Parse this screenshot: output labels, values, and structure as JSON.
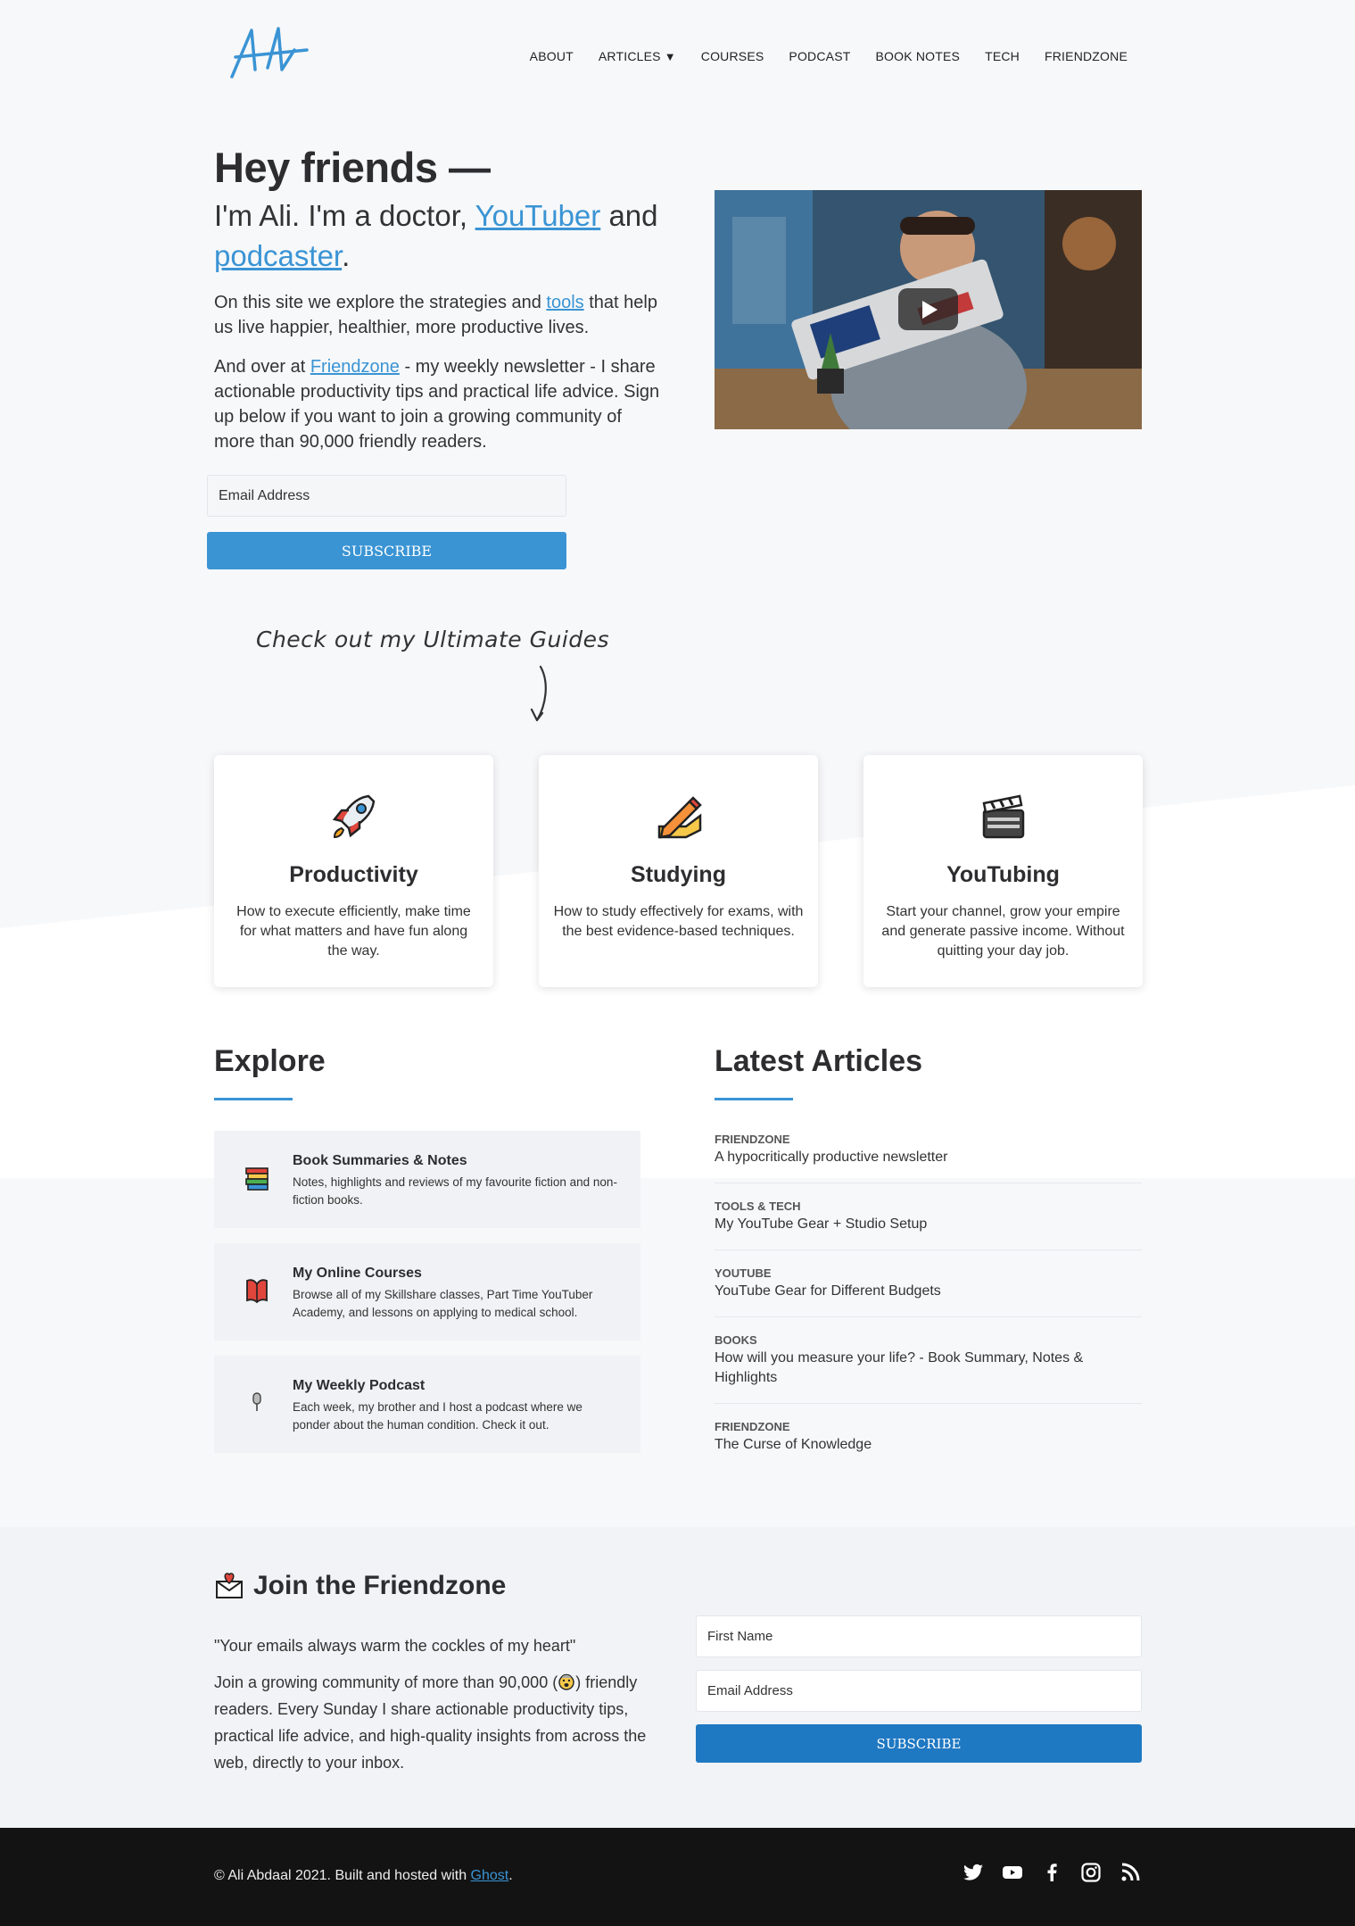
{
  "nav": {
    "items": [
      "ABOUT",
      "ARTICLES",
      "COURSES",
      "PODCAST",
      "BOOK NOTES",
      "TECH",
      "FRIENDZONE"
    ],
    "articles_caret": "▼"
  },
  "hero": {
    "title": "Hey friends —",
    "sub_pre": "I'm Ali. I'm a doctor, ",
    "sub_link1": "YouTuber",
    "sub_mid": " and ",
    "sub_link2": "podcaster",
    "sub_end": ".",
    "p1_pre": "On this site we explore the strategies and ",
    "p1_link": "tools",
    "p1_post": " that help us live happier, healthier, more productive lives.",
    "p2_pre": "And over at ",
    "p2_link": "Friendzone",
    "p2_post": " - my weekly newsletter - I share actionable productivity tips and practical life advice. Sign up below if you want to join a growing community of more than 90,000 friendly readers.",
    "email_placeholder": "Email Address",
    "subscribe": "SUBSCRIBE"
  },
  "guides": {
    "note": "Check out my Ultimate Guides",
    "cards": [
      {
        "title": "Productivity",
        "desc": "How to execute efficiently, make time for what matters and have fun along the way.",
        "icon": "rocket-icon"
      },
      {
        "title": "Studying",
        "desc": "How to study effectively for exams, with the best evidence-based techniques.",
        "icon": "pencil-icon"
      },
      {
        "title": "YouTubing",
        "desc": "Start your channel, grow your empire and generate passive income. Without quitting your day job.",
        "icon": "clapperboard-icon"
      }
    ]
  },
  "explore": {
    "title": "Explore",
    "items": [
      {
        "title": "Book Summaries & Notes",
        "desc": "Notes, highlights and reviews of my favourite fiction and non-fiction books.",
        "icon": "books-icon"
      },
      {
        "title": "My Online Courses",
        "desc": "Browse all of my Skillshare classes, Part Time YouTuber Academy, and lessons on applying to medical school.",
        "icon": "notebook-icon"
      },
      {
        "title": "My Weekly Podcast",
        "desc": "Each week, my brother and I host a podcast where we ponder about the human condition. Check it out.",
        "icon": "microphone-icon"
      }
    ]
  },
  "latest": {
    "title": "Latest Articles",
    "items": [
      {
        "tag": "FRIENDZONE",
        "title": "A hypocritically productive newsletter"
      },
      {
        "tag": "TOOLS & TECH",
        "title": "My YouTube Gear + Studio Setup"
      },
      {
        "tag": "YOUTUBE",
        "title": "YouTube Gear for Different Budgets"
      },
      {
        "tag": "BOOKS",
        "title": "How will you measure your life? - Book Summary, Notes & Highlights"
      },
      {
        "tag": "FRIENDZONE",
        "title": "The Curse of Knowledge"
      }
    ]
  },
  "join": {
    "title": "Join the Friendzone",
    "quote": "\"Your emails always warm the cockles of my heart\"",
    "p_pre": "Join a growing community of more than 90,000 (",
    "p_post": ") friendly readers. Every Sunday I share actionable productivity tips, practical life advice, and high-quality insights from across the web, directly to your inbox.",
    "first_name_placeholder": "First Name",
    "email_placeholder": "Email Address",
    "subscribe": "SUBSCRIBE"
  },
  "footer": {
    "copy_pre": "© Ali Abdaal 2021. Built and hosted with ",
    "copy_link": "Ghost",
    "copy_post": ".",
    "social": [
      "twitter-icon",
      "youtube-icon",
      "facebook-icon",
      "instagram-icon",
      "rss-icon"
    ]
  },
  "colors": {
    "accent": "#3a94d4",
    "button_dark": "#1f78c2",
    "footer_bg": "#131313"
  }
}
